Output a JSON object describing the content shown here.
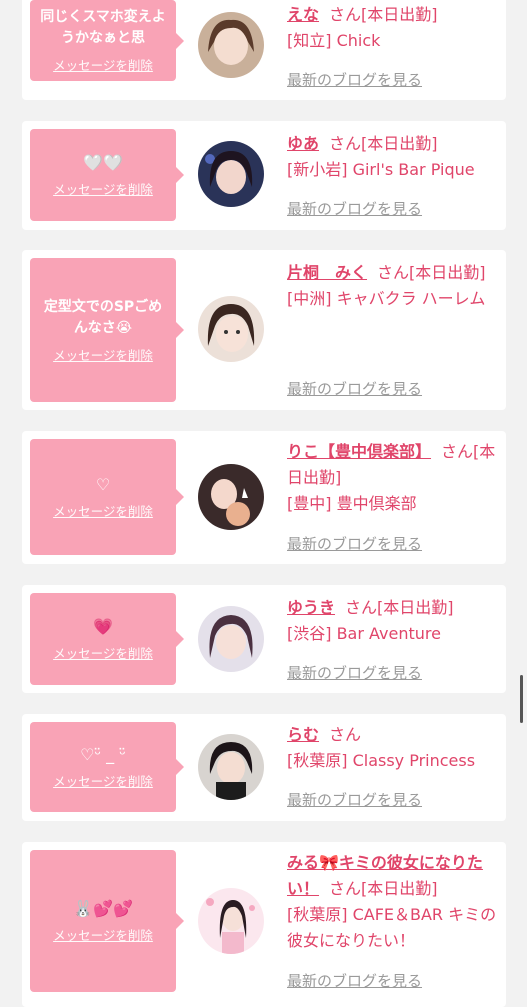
{
  "delete_label": "メッセージを削除",
  "blog_label": "最新のブログを見る",
  "san_label": "さん",
  "entries": [
    {
      "message": "同じくスマホ変えようかなぁと思",
      "name": "えな",
      "status": "[本日出勤]",
      "shop": "[知立] Chick",
      "avatar_icon": "girl-avatar-icon"
    },
    {
      "message": "🤍🤍",
      "name": "ゆあ",
      "status": "[本日出勤]",
      "shop": "[新小岩] Girl's Bar Pique",
      "avatar_icon": "girl-avatar-icon"
    },
    {
      "message": "定型文でのSPごめんなさ😭",
      "name": "片桐　みく",
      "status": "[本日出勤]",
      "shop": "[中洲] キャバクラ ハーレム",
      "avatar_icon": "girl-avatar-icon"
    },
    {
      "message": "♡",
      "name": "りこ【豊中倶楽部】",
      "status": "[本日出勤]",
      "shop": "[豊中] 豊中倶楽部",
      "avatar_icon": "girl-avatar-icon"
    },
    {
      "message": "💗",
      "name": "ゆうき",
      "status": "[本日出勤]",
      "shop": "[渋谷] Bar Aventure",
      "avatar_icon": "girl-avatar-icon"
    },
    {
      "message": "♡ᵕ̈ _ ᵕ̈",
      "name": "らむ",
      "status": "",
      "shop": "[秋葉原] Classy Princess",
      "avatar_icon": "girl-avatar-icon"
    },
    {
      "message": "🐰💕💕",
      "name": "みる🎀キミの彼女になりたい！",
      "status": "[本日出勤]",
      "shop": "[秋葉原] CAFE＆BAR キミの彼女になりたい！",
      "avatar_icon": "girl-avatar-icon"
    }
  ]
}
